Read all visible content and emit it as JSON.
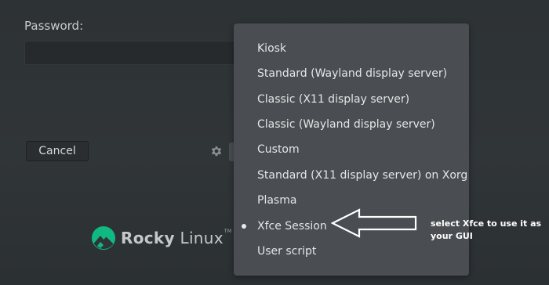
{
  "login": {
    "password_label": "Password:",
    "password_value": "",
    "cancel_label": "Cancel"
  },
  "settings": {
    "icon": "gear-icon"
  },
  "branding": {
    "logo_icon": "rocky-linux-logo",
    "logo_name_bold": "Rocky",
    "logo_name_rest": " Linux",
    "trademark": "TM",
    "accent_color": "#10b981"
  },
  "session_menu": {
    "selected": "Xfce Session",
    "items": [
      {
        "label": "Kiosk"
      },
      {
        "label": "Standard (Wayland display server)"
      },
      {
        "label": "Classic (X11 display server)"
      },
      {
        "label": "Classic (Wayland display server)"
      },
      {
        "label": "Custom"
      },
      {
        "label": "Standard (X11 display server) on Xorg"
      },
      {
        "label": "Plasma"
      },
      {
        "label": "Xfce Session"
      },
      {
        "label": "User script"
      }
    ]
  },
  "annotation": {
    "text": "select Xfce to use it as your GUI",
    "color": "#ffffff"
  },
  "colors": {
    "background": "#2f3437",
    "menu_background": "#4a4d51"
  }
}
